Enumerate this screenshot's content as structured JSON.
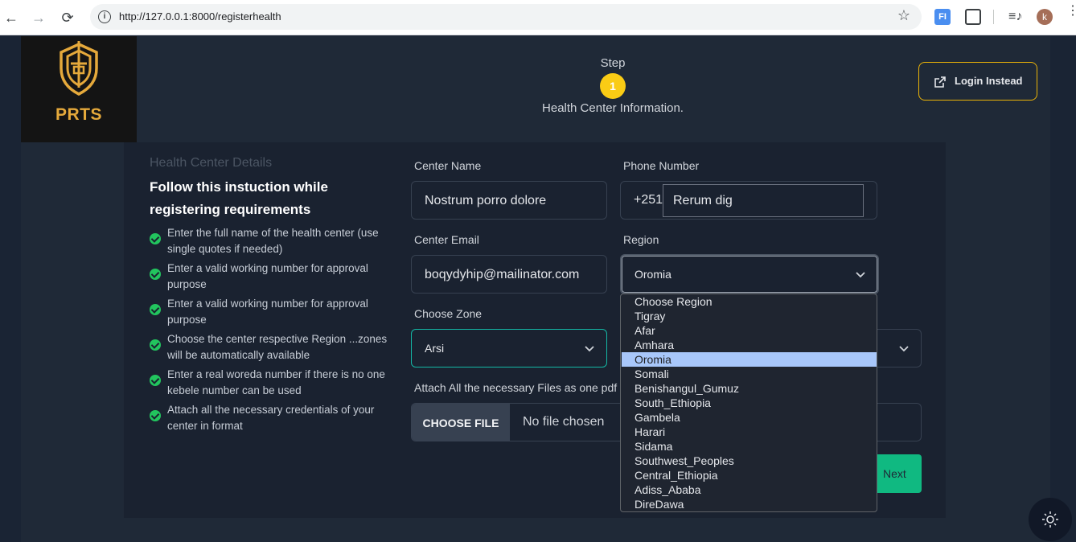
{
  "browser": {
    "back": "←",
    "forward": "→",
    "reload": "⟳",
    "url": "http://127.0.0.1:8000/registerhealth",
    "star": "☆",
    "ext_label": "FI",
    "profile_initial": "k"
  },
  "brand": {
    "logo_text": "PRTS",
    "accent_color": "#e5a93b"
  },
  "stepper": {
    "label": "Step",
    "number": "1",
    "title": "Health Center Information."
  },
  "header": {
    "login_label": "Login Instead"
  },
  "instructions": {
    "subtitle": "Health Center Details",
    "heading": "Follow this instuction while registering requirements",
    "items": [
      "Enter the full name of the health center (use single quotes if needed)",
      "Enter a valid working number for approval purpose",
      "Enter a valid working number for approval purpose",
      "Choose the center respective Region ...zones will be automatically available",
      "Enter a real woreda number if there is no one kebele number can be used",
      "Attach all the necessary credentials of your center in format"
    ]
  },
  "form": {
    "center_name_label": "Center Name",
    "center_name_value": "Nostrum porro dolore",
    "phone_label": "Phone Number",
    "phone_prefix": "+251",
    "phone_value": "Rerum dig",
    "email_label": "Center Email",
    "email_value": "boqydyhip@mailinator.com",
    "region_label": "Region",
    "region_value": "Oromia",
    "zone_label": "Choose Zone",
    "zone_value": "Arsi",
    "attach_label": "Attach All the necessary Files as one pdf",
    "file_button": "CHOOSE FILE",
    "file_status": "No file chosen",
    "next_label": "Next"
  },
  "region_options": [
    "Choose Region",
    "Tigray",
    "Afar",
    "Amhara",
    "Oromia",
    "Somali",
    "Benishangul_Gumuz",
    "South_Ethiopia",
    "Gambela",
    "Harari",
    "Sidama",
    "Southwest_Peoples",
    "Central_Ethiopia",
    "Adiss_Ababa",
    "DireDawa"
  ]
}
